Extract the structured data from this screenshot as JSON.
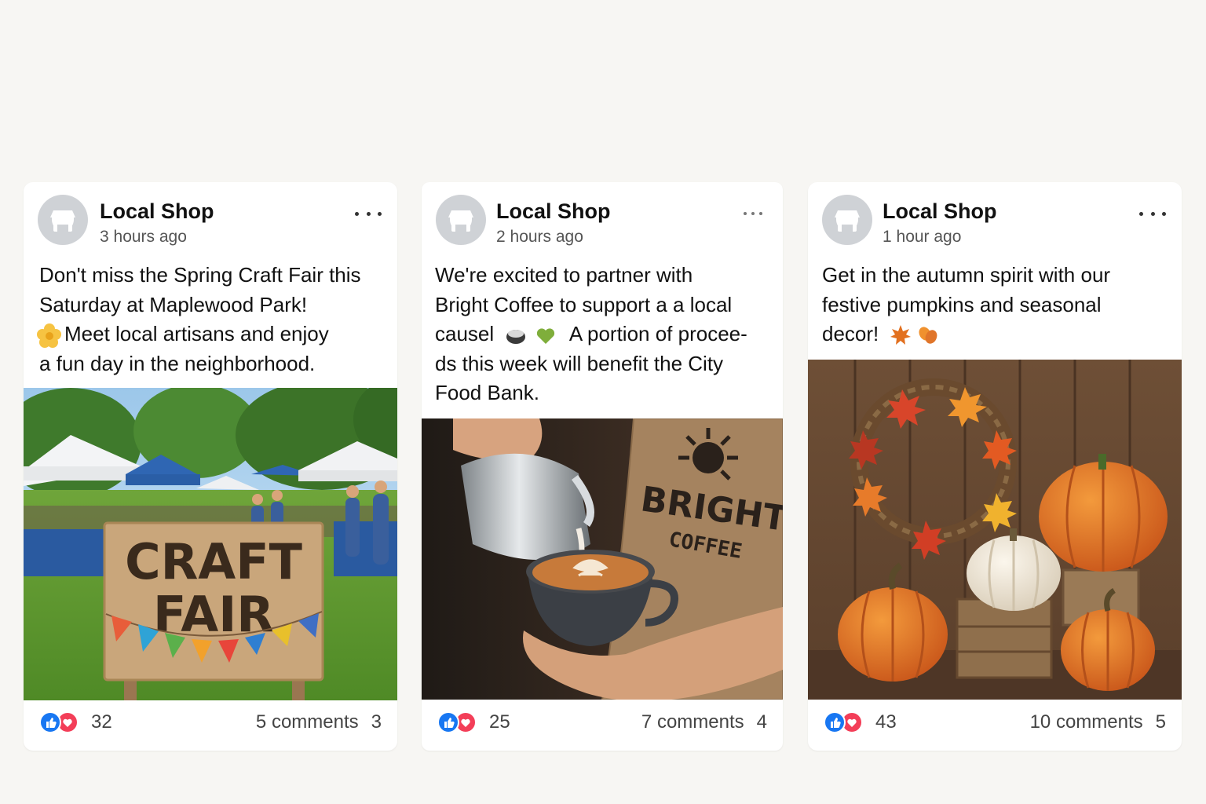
{
  "posts": [
    {
      "author": "Local Shop",
      "time": "3 hours ago",
      "text_lines": [
        "Don't miss the Spring Craft Fair this",
        "Saturday at Maplewood Park!",
        "Meet local artisans and enjoy",
        "a fun day in the neighborhood."
      ],
      "image": {
        "sign_line1": "CRAFT",
        "sign_line2": "FAIR"
      },
      "reactions": "32",
      "comments": "5 comments",
      "shares": "3"
    },
    {
      "author": "Local Shop",
      "time": "2 hours ago",
      "text_lines": [
        "We're excited to partner with",
        "Bright Coffee to support a a local",
        "causel",
        "A portion of procee-",
        "ds this week will benefit the City",
        "Food Bank."
      ],
      "image": {
        "brand_line1": "BRIGHT",
        "brand_line2": "COFFEE"
      },
      "reactions": "25",
      "comments": "7 comments",
      "shares": "4"
    },
    {
      "author": "Local Shop",
      "time": "1 hour ago",
      "text_lines": [
        "Get in the autumn spirit with our",
        "festive pumpkins and seasonal",
        "decor!"
      ],
      "reactions": "43",
      "comments": "10 comments",
      "shares": "5"
    }
  ],
  "icons": {
    "avatar": "store-icon",
    "menu": "more-options-icon",
    "reaction_1": "like-reaction-icon",
    "reaction_2": "love-reaction-icon"
  },
  "colors": {
    "like": "#1877f2",
    "love": "#f33e58",
    "avatar_bg": "#cfd2d6",
    "page_bg": "#f7f6f3"
  }
}
